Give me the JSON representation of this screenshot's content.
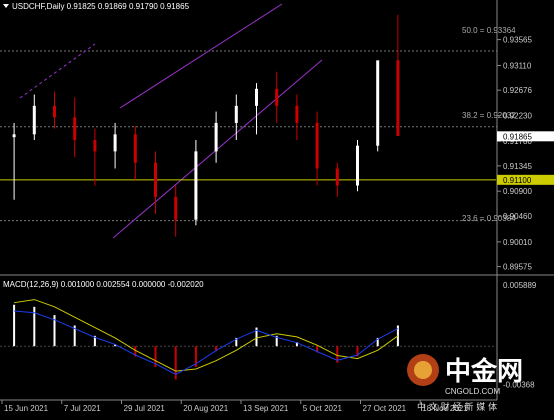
{
  "header": {
    "symbol_line": "USDCHF,Daily  0.91825 0.91869 0.91790 0.91865"
  },
  "indicator": {
    "label": "MACD(12,26,9) 0.001000 0.002554 0.000000 -0.002020"
  },
  "fib_labels": {
    "f50": "50.0 = 0.93364",
    "f382": "38.2 = 0.92032",
    "f236": "23.6 = 0.90384"
  },
  "watermark": {
    "brand": "中金网",
    "site": "CNGOLD.COM",
    "tagline": "中 文 财 经 新 媒 体"
  },
  "colors": {
    "bg": "#000000",
    "bull": "#ffffff",
    "bear": "#cc0000",
    "grid": "#555555",
    "axis_text": "#cccccc",
    "channel": "#9933cc",
    "hline": "#cccc00",
    "signal": "#cccc00",
    "macd": "#1b3df0",
    "pos_hist": "#ffffff",
    "neg_hist": "#cc0000",
    "price_tag": "#ffffff",
    "price_tag_text": "#000000",
    "yellow_tag": "#cccc00",
    "yellow_tag_text": "#000000"
  },
  "chart_data": [
    {
      "type": "candlestick",
      "title": "USDCHF,Daily  0.91825 0.91869 0.91790 0.91865",
      "ylim": [
        0.8948,
        0.9405
      ],
      "yticks": [
        0.93565,
        0.9311,
        0.92676,
        0.9223,
        0.9178,
        0.91345,
        0.909,
        0.9046,
        0.9001,
        0.89575
      ],
      "ytick_labels": [
        "0.93565",
        "0.93110",
        "0.92676",
        "0.92230",
        "0.91780",
        "0.91345",
        "0.90900",
        "0.90460",
        "0.90010",
        "0.89575"
      ],
      "current_price": 0.91865,
      "current_price_label": "0.91865",
      "hline": 0.911,
      "hline_label": "0.91100",
      "fib_levels": [
        0.93364,
        0.92032,
        0.90384
      ],
      "xtick_labels": [
        "15 Jun 2021",
        "7 Jul 2021",
        "29 Jul 2021",
        "20 Aug 2021",
        "13 Sep 2021",
        "5 Oct 2021",
        "27 Oct 2021",
        "18 Nov 2021"
      ],
      "candles": [
        [
          0.9185,
          0.921,
          0.9075,
          0.919
        ],
        [
          0.919,
          0.926,
          0.918,
          0.924
        ],
        [
          0.924,
          0.9265,
          0.92,
          0.922
        ],
        [
          0.922,
          0.9255,
          0.915,
          0.918
        ],
        [
          0.918,
          0.92,
          0.91,
          0.916
        ],
        [
          0.916,
          0.921,
          0.913,
          0.919
        ],
        [
          0.919,
          0.9205,
          0.911,
          0.914
        ],
        [
          0.914,
          0.916,
          0.905,
          0.908
        ],
        [
          0.908,
          0.91,
          0.901,
          0.904
        ],
        [
          0.904,
          0.918,
          0.903,
          0.916
        ],
        [
          0.916,
          0.923,
          0.914,
          0.921
        ],
        [
          0.921,
          0.926,
          0.918,
          0.924
        ],
        [
          0.924,
          0.928,
          0.919,
          0.927
        ],
        [
          0.927,
          0.93,
          0.921,
          0.924
        ],
        [
          0.924,
          0.926,
          0.918,
          0.921
        ],
        [
          0.921,
          0.923,
          0.91,
          0.913
        ],
        [
          0.913,
          0.914,
          0.908,
          0.91
        ],
        [
          0.91,
          0.918,
          0.909,
          0.917
        ],
        [
          0.917,
          0.931,
          0.916,
          0.932
        ],
        [
          0.932,
          0.94,
          0.93,
          0.9187
        ]
      ]
    },
    {
      "type": "macd",
      "title": "MACD(12,26,9) 0.001000 0.002554 0.000000 -0.002020",
      "ylim": [
        -0.005,
        0.0061
      ],
      "yticks": [
        0.005889,
        -0.00368
      ],
      "ytick_labels": [
        "0.005889",
        "-0.00368"
      ],
      "histogram": [
        0.004,
        0.0038,
        0.003,
        0.002,
        0.001,
        0.0002,
        -0.001,
        -0.002,
        -0.0032,
        -0.002,
        -0.0005,
        0.0008,
        0.0018,
        0.001,
        0.0004,
        -0.0006,
        -0.0016,
        -0.001,
        0.0008,
        0.002
      ],
      "signal": [
        0.0042,
        0.0045,
        0.0038,
        0.0028,
        0.0018,
        0.0008,
        -0.0004,
        -0.0014,
        -0.0024,
        -0.0022,
        -0.0014,
        -0.0004,
        0.0008,
        0.0012,
        0.0009,
        0.0001,
        -0.0009,
        -0.0012,
        -0.0004,
        0.001
      ]
    }
  ]
}
